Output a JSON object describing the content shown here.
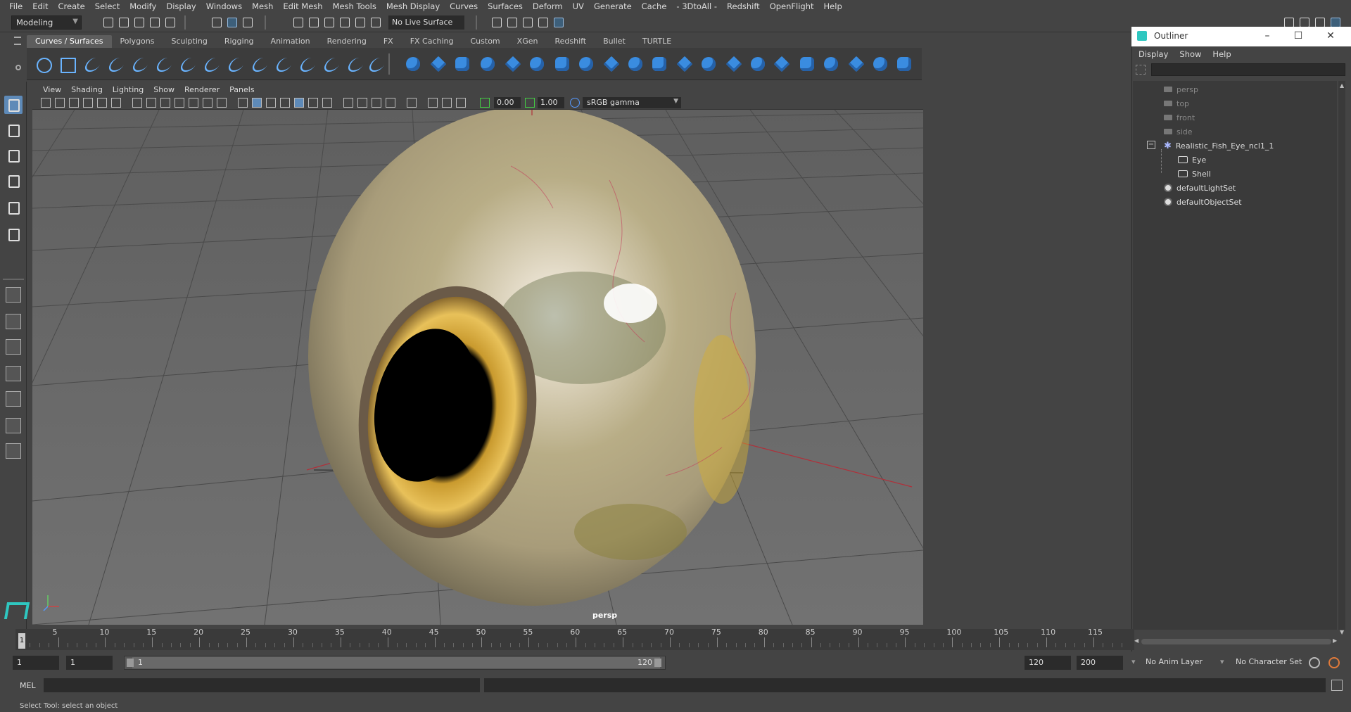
{
  "menubar": {
    "items": [
      "File",
      "Edit",
      "Create",
      "Select",
      "Modify",
      "Display",
      "Windows",
      "Mesh",
      "Edit Mesh",
      "Mesh Tools",
      "Mesh Display",
      "Curves",
      "Surfaces",
      "Deform",
      "UV",
      "Generate",
      "Cache",
      "- 3DtoAll -",
      "Redshift",
      "OpenFlight",
      "Help"
    ]
  },
  "statusline": {
    "mode": "Modeling",
    "live_surface": "No Live Surface"
  },
  "shelf": {
    "tabs": [
      "Curves / Surfaces",
      "Polygons",
      "Sculpting",
      "Rigging",
      "Animation",
      "Rendering",
      "FX",
      "FX Caching",
      "Custom",
      "XGen",
      "Redshift",
      "Bullet",
      "TURTLE"
    ],
    "active_tab": "Curves / Surfaces"
  },
  "viewport": {
    "menu": [
      "View",
      "Shading",
      "Lighting",
      "Show",
      "Renderer",
      "Panels"
    ],
    "exposure": "0.00",
    "gamma": "1.00",
    "colorspace": "sRGB gamma",
    "camera_label": "persp"
  },
  "outliner": {
    "title": "Outliner",
    "menu": [
      "Display",
      "Show",
      "Help"
    ],
    "items": [
      {
        "label": "persp",
        "type": "camera"
      },
      {
        "label": "top",
        "type": "camera"
      },
      {
        "label": "front",
        "type": "camera"
      },
      {
        "label": "side",
        "type": "camera"
      },
      {
        "label": "Realistic_Fish_Eye_ncl1_1",
        "type": "group"
      },
      {
        "label": "Eye",
        "type": "mesh"
      },
      {
        "label": "Shell",
        "type": "mesh"
      },
      {
        "label": "defaultLightSet",
        "type": "set"
      },
      {
        "label": "defaultObjectSet",
        "type": "set"
      }
    ]
  },
  "timeslider": {
    "current_frame": "1",
    "ticks": [
      "5",
      "10",
      "15",
      "20",
      "25",
      "30",
      "35",
      "40",
      "45",
      "50",
      "55",
      "60",
      "65",
      "70",
      "75",
      "80",
      "85",
      "90",
      "95",
      "100",
      "105",
      "110",
      "115"
    ]
  },
  "range": {
    "start_field": "1",
    "start_field2": "1",
    "range_start": "1",
    "range_end": "120",
    "end_field": "120",
    "end_field2": "200",
    "anim_layer": "No Anim Layer",
    "character_set": "No Character Set"
  },
  "cmdline": {
    "label": "MEL"
  },
  "helpline": {
    "text": "Select Tool: select an object"
  }
}
